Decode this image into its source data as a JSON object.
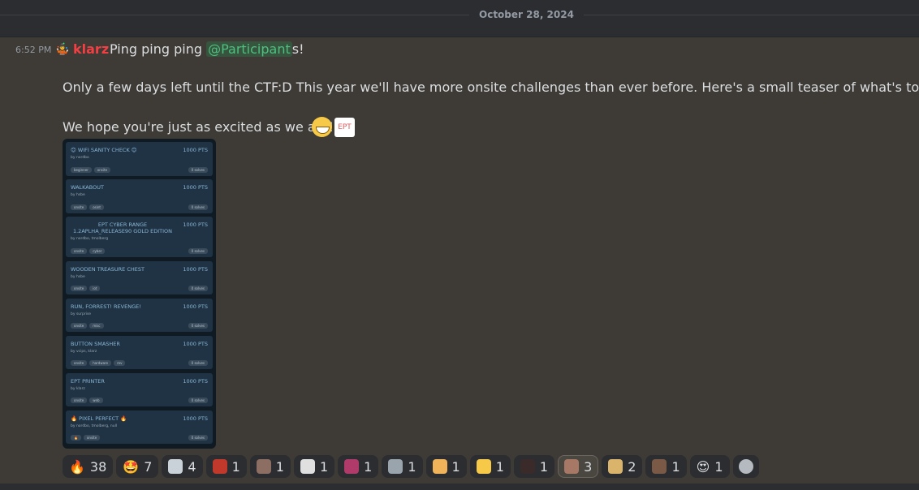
{
  "header": {
    "date": "October 28, 2024"
  },
  "message": {
    "time": "6:52 PM",
    "avatar": "🤹",
    "author": "klarz",
    "line1_pre": "Ping ping ping ",
    "mention": "@Participant",
    "line1_post": "s!",
    "line2": "Only a few days left until the CTF:D This year we'll have more onsite challenges than ever before. Here's a small teaser of what's to come.",
    "line3": "We hope you're just as excited as we are!",
    "inline_emoji_2_text": "EPT"
  },
  "attachment": {
    "cards": [
      {
        "title": "😊 WIFI SANITY CHECK 😊",
        "points": "1000 PTS",
        "by": "by nordbo",
        "tags": [
          "beginner",
          "onsite"
        ],
        "solves": "0 solves"
      },
      {
        "title": "WALKABOUT",
        "points": "1000 PTS",
        "by": "by hsbe",
        "tags": [
          "onsite",
          "osint"
        ],
        "solves": "0 solves"
      },
      {
        "title": "EPT CYBER RANGE 1.2APLHA_RELEASE90 GOLD EDITION",
        "points": "1000 PTS",
        "by": "by nordbo, tmolberg",
        "tags": [
          "onsite",
          "cyber"
        ],
        "solves": "0 solves"
      },
      {
        "title": "WOODEN TREASURE CHEST",
        "points": "1000 PTS",
        "by": "by hsbe",
        "tags": [
          "onsite",
          "iot"
        ],
        "solves": "0 solves"
      },
      {
        "title": "RUN, FORREST! REVENGE!",
        "points": "1000 PTS",
        "by": "by surprise",
        "tags": [
          "onsite",
          "misc"
        ],
        "solves": "0 solves"
      },
      {
        "title": "BUTTON SMASHER",
        "points": "1000 PTS",
        "by": "by vcips, klarz",
        "tags": [
          "onsite",
          "hardware",
          "rev"
        ],
        "solves": "0 solves"
      },
      {
        "title": "EPT PRINTER",
        "points": "1000 PTS",
        "by": "by klarz",
        "tags": [
          "onsite",
          "web"
        ],
        "solves": "0 solves"
      },
      {
        "title": "🔥 PIXEL PERFECT 🔥",
        "points": "1000 PTS",
        "by": "by nordbo, tmolberg, null",
        "tags": [
          "🔥",
          "onsite"
        ],
        "solves": "0 solves"
      }
    ]
  },
  "reactions": [
    {
      "emoji": "🔥",
      "count": "38"
    },
    {
      "emoji": "🤩",
      "count": "7"
    },
    {
      "icon": "custom-portrait",
      "color": "#c9d2d8",
      "count": "4"
    },
    {
      "icon": "custom-red-figure",
      "color": "#c0392b",
      "count": "1"
    },
    {
      "icon": "custom-face",
      "color": "#8d6e63",
      "count": "1"
    },
    {
      "icon": "custom-goat",
      "color": "#e0e0e0",
      "count": "1"
    },
    {
      "icon": "custom-pink-glitch",
      "color": "#b03a6a",
      "count": "1"
    },
    {
      "icon": "custom-robot",
      "color": "#9aa4ad",
      "count": "1"
    },
    {
      "icon": "custom-person-laptop",
      "color": "#f0b35a",
      "count": "1"
    },
    {
      "icon": "custom-face-hushed",
      "color": "#f7c948",
      "count": "1"
    },
    {
      "icon": "custom-dark-orb",
      "color": "#3a2a2a",
      "count": "1"
    },
    {
      "icon": "custom-brown-shape",
      "color": "#a87866",
      "count": "3",
      "active": true
    },
    {
      "icon": "custom-doge",
      "color": "#d9b46a",
      "count": "2"
    },
    {
      "icon": "custom-dog-photo",
      "color": "#7a5a46",
      "count": "1"
    },
    {
      "emoji": "😍",
      "count": "1"
    }
  ]
}
